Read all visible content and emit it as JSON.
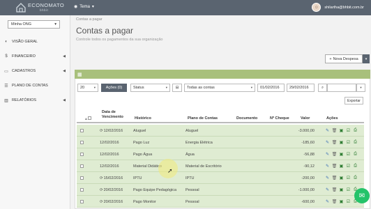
{
  "topbar": {
    "logo_text": "ECONOMATO",
    "logo_sub": "bhbit",
    "theme_label": "Tema",
    "user_email": "shilartha@bhbit.com.br"
  },
  "sidebar": {
    "org": "Minha ONG",
    "items": [
      {
        "label": "VISÃO GERAL",
        "icon": "gauge-icon",
        "glyph": "◐",
        "caret": ""
      },
      {
        "label": "FINANCEIRO",
        "icon": "money-icon",
        "glyph": "$",
        "caret": "◀"
      },
      {
        "label": "CADASTROS",
        "icon": "folder-icon",
        "glyph": "▭",
        "caret": "◀"
      },
      {
        "label": "PLANO DE CONTAS",
        "icon": "list-icon",
        "glyph": "☰",
        "caret": ""
      },
      {
        "label": "RELATÓRIOS",
        "icon": "chart-icon",
        "glyph": "▥",
        "caret": "◀"
      }
    ]
  },
  "header": {
    "breadcrumb": "Contas a pagar",
    "title": "Contas a pagar",
    "subtitle": "Controle todos os pagamentos da sua organização",
    "new_button": "Nova Despesa"
  },
  "filters": {
    "per_page": "20",
    "actions": "Ações (0)",
    "status": "Status",
    "accounts": "Todas as contas",
    "date_from": "01/02/2016",
    "date_to": "29/02/2016",
    "export": "Exportar"
  },
  "table": {
    "headers": {
      "date": [
        "Data de",
        "Vencimento"
      ],
      "history": "Histórico",
      "plan": "Plano de Contas",
      "document": "Documento",
      "cheque": "Nº Cheque",
      "value": "Valor",
      "actions": "Ações"
    },
    "rows": [
      {
        "date": "12/02/2016",
        "recurring": true,
        "history": "Aluguel",
        "plan": "Aluguel",
        "document": "",
        "cheque": "",
        "value": "-3.000,00"
      },
      {
        "date": "12/02/2016",
        "recurring": false,
        "history": "Pago Luz",
        "plan": "Energia Elétrica",
        "document": "",
        "cheque": "",
        "value": "-185,60"
      },
      {
        "date": "12/02/2016",
        "recurring": false,
        "history": "Pago Água",
        "plan": "Água",
        "document": "",
        "cheque": "",
        "value": "-56,88"
      },
      {
        "date": "12/02/2016",
        "recurring": false,
        "history": "Material Didático",
        "plan": "Material de Escritório",
        "document": "",
        "cheque": "",
        "value": "-90,12"
      },
      {
        "date": "15/02/2016",
        "recurring": true,
        "history": "IPTU",
        "plan": "IPTU",
        "document": "",
        "cheque": "",
        "value": "-200,00"
      },
      {
        "date": "20/02/2016",
        "recurring": true,
        "history": "Pago Equipe Pedagógica",
        "plan": "Pessoal",
        "document": "",
        "cheque": "",
        "value": "-1.000,00"
      },
      {
        "date": "20/02/2016",
        "recurring": true,
        "history": "Pago Monitor",
        "plan": "Pessoal",
        "document": "",
        "cheque": "",
        "value": "-600,00"
      }
    ]
  },
  "colors": {
    "topbar": "#5a6470",
    "panel_header": "#a8c07c",
    "row_bg": "#dfecd2",
    "edit": "#3b6fb6",
    "trash": "#666666",
    "money": "#2e7d32",
    "check": "#2e7d32",
    "print": "#2e7d32",
    "chat": "#25c36a"
  }
}
